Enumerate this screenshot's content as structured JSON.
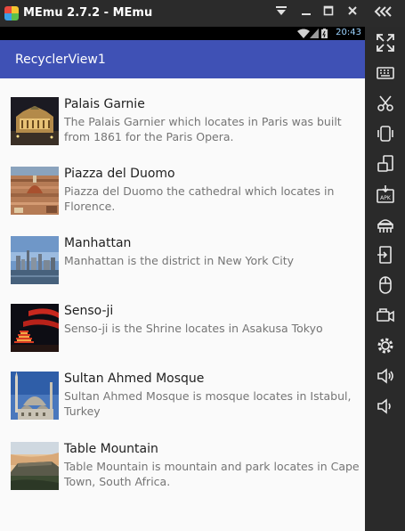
{
  "window": {
    "title": "MEmu 2.7.2 - MEmu",
    "controls": [
      "menu-icon",
      "minimize-icon",
      "maximize-icon",
      "close-icon"
    ],
    "sidebar_toggle": "«‹"
  },
  "statusbar": {
    "time": "20:43",
    "icons": [
      "wifi-icon",
      "signal-icon",
      "battery-icon"
    ]
  },
  "appbar": {
    "title": "RecyclerView1",
    "color": "#3f51b5"
  },
  "list": {
    "items": [
      {
        "title": "Palais Garnie",
        "description": "The Palais Garnier which locates in Paris was built from 1861 for the Paris Opera."
      },
      {
        "title": "Piazza del Duomo",
        "description": "Piazza del Duomo the cathedral which locates in Florence."
      },
      {
        "title": "Manhattan",
        "description": "Manhattan is the district in New York City"
      },
      {
        "title": "Senso-ji",
        "description": "Senso-ji is the Shrine locates in Asakusa Tokyo"
      },
      {
        "title": "Sultan Ahmed Mosque",
        "description": "Sultan Ahmed Mosque is mosque locates in Istabul, Turkey"
      },
      {
        "title": "Table Mountain",
        "description": "Table Mountain is mountain and park locates in Cape Town, South Africa."
      }
    ]
  },
  "sidebar": {
    "buttons": [
      "fullscreen-icon",
      "keyboard-icon",
      "scissors-icon",
      "shake-icon",
      "rotate-icon",
      "apk-install-icon",
      "android-toolbar-icon",
      "usb-transfer-icon",
      "mouse-icon",
      "video-record-icon",
      "settings-gear-icon",
      "volume-up-icon",
      "volume-down-icon"
    ]
  }
}
